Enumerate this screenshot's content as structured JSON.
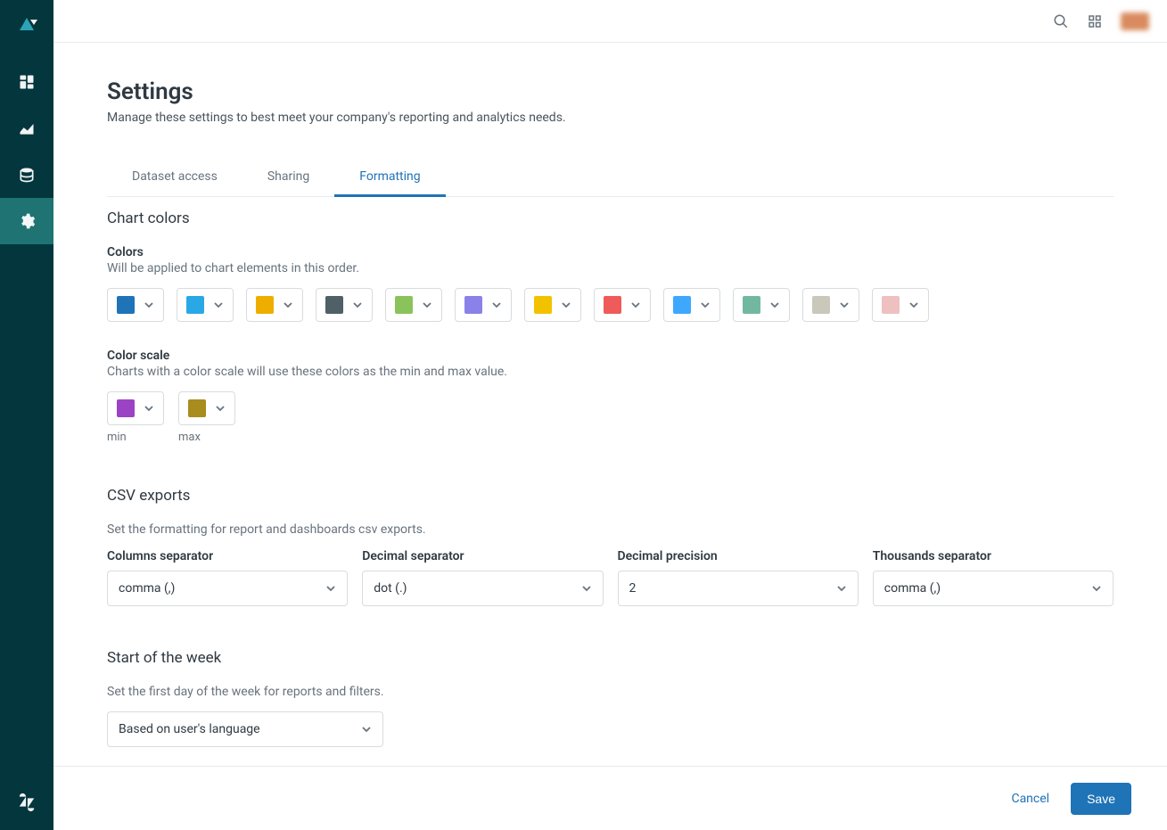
{
  "page": {
    "title": "Settings",
    "subtitle": "Manage these settings to best meet your company's reporting and analytics needs."
  },
  "tabs": [
    {
      "label": "Dataset access",
      "active": false
    },
    {
      "label": "Sharing",
      "active": false
    },
    {
      "label": "Formatting",
      "active": true
    }
  ],
  "chart_colors": {
    "section_title": "Chart colors",
    "colors_label": "Colors",
    "colors_desc": "Will be applied to chart elements in this order.",
    "palette": [
      "#1f73b7",
      "#2aa8e5",
      "#eeae00",
      "#4f6066",
      "#8ac35b",
      "#8a82e8",
      "#f2c200",
      "#ef5b5b",
      "#3ea8ff",
      "#72b8a0",
      "#c9c8bb",
      "#eec0c0"
    ],
    "scale_label": "Color scale",
    "scale_desc": "Charts with a color scale will use these colors as the min and max value.",
    "scale_min_color": "#9b43c4",
    "scale_max_color": "#a88c1e",
    "min_label": "min",
    "max_label": "max"
  },
  "csv": {
    "section_title": "CSV exports",
    "desc": "Set the formatting for report and dashboards csv exports.",
    "fields": {
      "columns_separator": {
        "label": "Columns separator",
        "value": "comma (,)"
      },
      "decimal_separator": {
        "label": "Decimal separator",
        "value": "dot (.)"
      },
      "decimal_precision": {
        "label": "Decimal precision",
        "value": "2"
      },
      "thousands_separator": {
        "label": "Thousands separator",
        "value": "comma (,)"
      }
    }
  },
  "week": {
    "section_title": "Start of the week",
    "desc": "Set the first day of the week for reports and filters.",
    "value": "Based on user's language"
  },
  "footer": {
    "cancel": "Cancel",
    "save": "Save"
  }
}
